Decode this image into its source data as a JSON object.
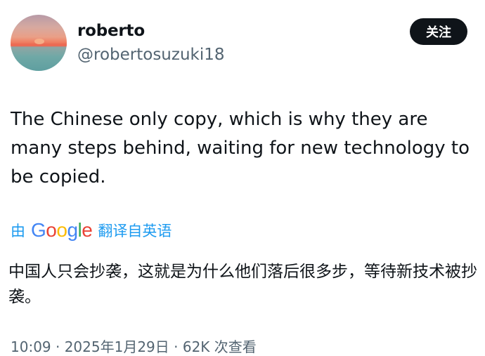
{
  "user": {
    "display_name": "roberto",
    "handle": "@robertosuzuki18",
    "follow_label": "关注"
  },
  "tweet": {
    "text": "The Chinese only copy, which is why they are many steps behind, waiting for new technology to be copied."
  },
  "translation": {
    "prefix": "由",
    "provider": "Google",
    "suffix": "翻译自英语",
    "text": "中国人只会抄袭，这就是为什么他们落后很多步，等待新技术被抄袭。"
  },
  "meta": {
    "partial_text": "10:09 · 2025年1月29日 · 62K 次查看"
  },
  "colors": {
    "text": "#0f1419",
    "secondary": "#536471",
    "link": "#1d9bf0",
    "follow_bg": "#0f1419"
  },
  "icons": {
    "avatar": "sunset-avatar-image",
    "google_logo": "google-wordmark"
  }
}
